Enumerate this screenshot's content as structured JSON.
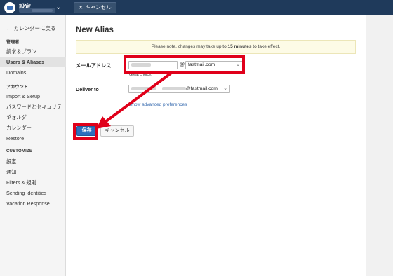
{
  "topbar": {
    "title": "設定",
    "cancel_label": "キャンセル",
    "cancel_icon": "close-icon",
    "chevron_icon": "chevron-down-icon"
  },
  "sidebar": {
    "back_label": "カレンダーに戻る",
    "section_admin": "管理者",
    "items_admin": [
      "請求＆プラン",
      "Users & Aliases",
      "Domains"
    ],
    "section_account": "アカウント",
    "items_account": [
      "Import & Setup",
      "パスワードとセキュリティ",
      "フォルダ",
      "カレンダー",
      "Restore"
    ],
    "section_customize": "CUSTOMIZE",
    "items_customize": [
      "設定",
      "通知",
      "Filters & 規則",
      "Sending Identities",
      "Vacation Response"
    ],
    "active_item": "Users & Aliases"
  },
  "main": {
    "title": "New Alias",
    "notice_pre": "Please note, changes may take up to ",
    "notice_bold": "15 minutes",
    "notice_post": " to take effect.",
    "email_label": "メールアドレス",
    "at_sign": "@",
    "domain_value": "fastmail.com",
    "email_hint": "Great choice.",
    "deliver_label": "Deliver to",
    "deliver_domain": "@fastmail.com",
    "advanced_link": "Show advanced preferences",
    "save_label": "保存",
    "cancel_label": "キャンセル"
  },
  "colors": {
    "topbar": "#1f3a5b",
    "accent": "#2c6fbd",
    "annotation": "#e0001a"
  }
}
